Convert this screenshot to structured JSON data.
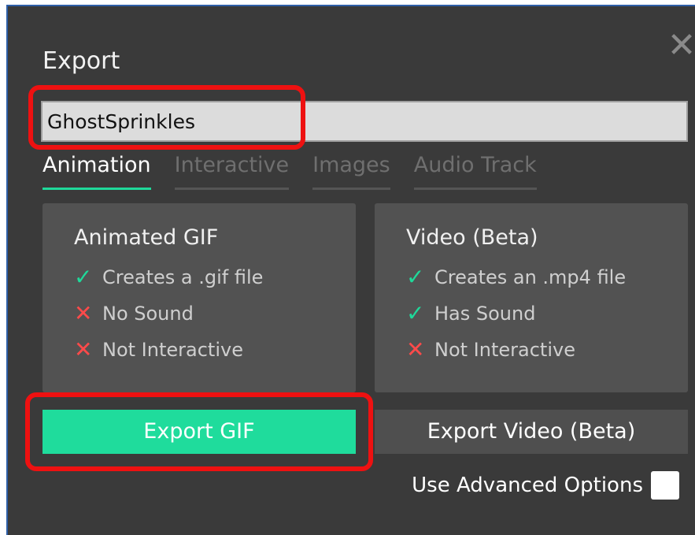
{
  "dialog": {
    "title": "Export",
    "close_symbol": "✕",
    "name_field": {
      "value": "GhostSprinkles"
    },
    "tabs": [
      {
        "label": "Animation",
        "active": true
      },
      {
        "label": "Interactive",
        "active": false
      },
      {
        "label": "Images",
        "active": false
      },
      {
        "label": "Audio Track",
        "active": false
      }
    ]
  },
  "cards": {
    "gif": {
      "title": "Animated GIF",
      "features": [
        {
          "icon": "check-icon",
          "symbol": "✓",
          "text": "Creates a .gif file"
        },
        {
          "icon": "x-icon",
          "symbol": "✕",
          "text": "No Sound"
        },
        {
          "icon": "x-icon",
          "symbol": "✕",
          "text": "Not Interactive"
        }
      ],
      "button_label": "Export GIF"
    },
    "video": {
      "title": "Video (Beta)",
      "features": [
        {
          "icon": "check-icon",
          "symbol": "✓",
          "text": "Creates an .mp4 file"
        },
        {
          "icon": "check-icon",
          "symbol": "✓",
          "text": "Has Sound"
        },
        {
          "icon": "x-icon",
          "symbol": "✕",
          "text": "Not Interactive"
        }
      ],
      "button_label": "Export Video (Beta)"
    }
  },
  "advanced": {
    "label": "Use Advanced Options",
    "checked": false
  },
  "colors": {
    "accent": "#1fdc9c",
    "error": "#ff4a4a",
    "highlight": "#ee1111",
    "background": "#3a3a3a"
  }
}
